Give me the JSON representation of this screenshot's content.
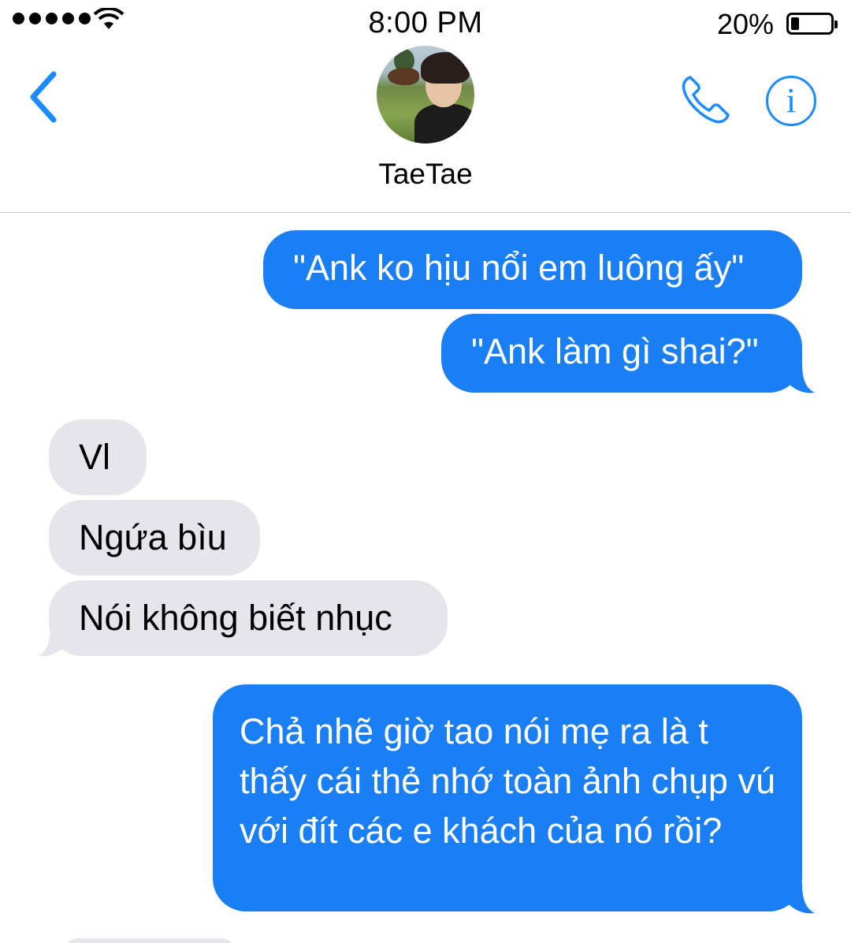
{
  "status_bar": {
    "time": "8:00 PM",
    "battery_percent_label": "20%",
    "battery_level": 0.2,
    "signal_bars": 5,
    "icons": [
      "signal-dots-icon",
      "wifi-icon",
      "battery-icon"
    ]
  },
  "header": {
    "contact_name": "TaeTae",
    "icons": [
      "back-chevron-icon",
      "phone-icon",
      "info-icon"
    ],
    "info_glyph": "i"
  },
  "colors": {
    "accent": "#1a8cff",
    "sent_bubble": "#1a7ff5",
    "received_bubble": "#e6e5eb",
    "divider": "#c8c7cc"
  },
  "messages": [
    {
      "direction": "sent",
      "text": "\"Ank ko hịu nổi em luông ấy\""
    },
    {
      "direction": "sent",
      "text": "\"Ank làm gì shai?\""
    },
    {
      "direction": "received",
      "text": "Vl"
    },
    {
      "direction": "received",
      "text": "Ngứa bìu"
    },
    {
      "direction": "received",
      "text": "Nói không biết nhục"
    },
    {
      "direction": "sent",
      "text": "Chả nhẽ giờ tao nói mẹ ra là t thấy cái thẻ nhớ toàn ảnh chụp vú với đít các e khách của nó rồi?"
    }
  ]
}
